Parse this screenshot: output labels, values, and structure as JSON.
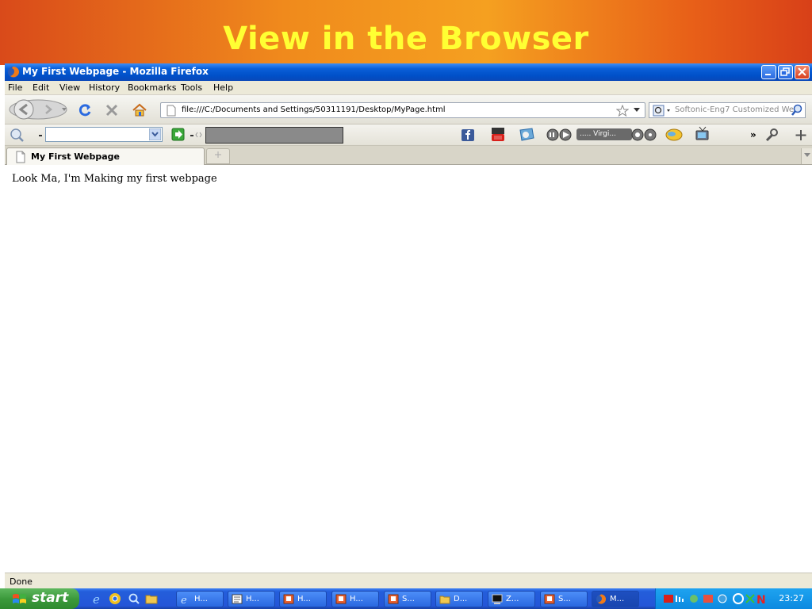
{
  "slide": {
    "title": "View in the Browser"
  },
  "window": {
    "title": "My First Webpage - Mozilla Firefox"
  },
  "menu": [
    "File",
    "Edit",
    "View",
    "History",
    "Bookmarks",
    "Tools",
    "Help"
  ],
  "navbar": {
    "url": "file:///C:/Documents and Settings/50311191/Desktop/MyPage.html",
    "search_placeholder": "Softonic-Eng7 Customized We"
  },
  "toolbar2": {
    "radio_label": "..... Virgi...",
    "more": "»"
  },
  "tabs": [
    {
      "label": "My First Webpage"
    }
  ],
  "content": {
    "text": "Look Ma, I'm Making my first webpage"
  },
  "status": {
    "text": "Done"
  },
  "taskbar": {
    "start_label": "start",
    "items": [
      {
        "label": "H...",
        "icon": "ie-icon"
      },
      {
        "label": "H...",
        "icon": "document-icon"
      },
      {
        "label": "H...",
        "icon": "ppt-icon"
      },
      {
        "label": "H...",
        "icon": "ppt-icon"
      },
      {
        "label": "S...",
        "icon": "ppt-icon"
      },
      {
        "label": "D...",
        "icon": "folder-icon"
      },
      {
        "label": "Z...",
        "icon": "terminal-icon"
      },
      {
        "label": "S...",
        "icon": "ppt-icon"
      },
      {
        "label": "M...",
        "icon": "firefox-icon"
      }
    ],
    "clock": "23:27"
  },
  "colors": {
    "title_text": "#ffff33",
    "xp_blue": "#0a5fd8",
    "start_green": "#3c9a3c"
  }
}
